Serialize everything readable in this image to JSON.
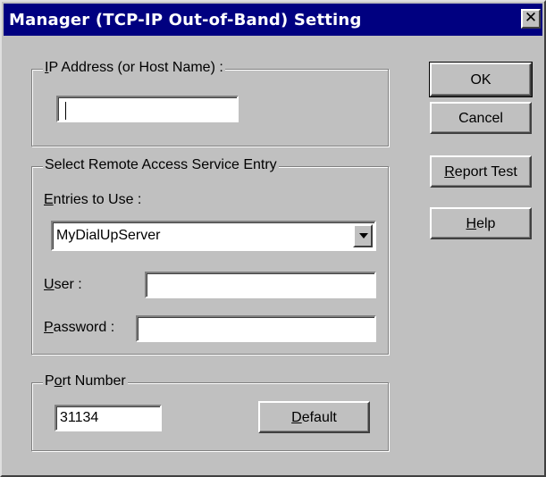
{
  "window": {
    "title": "Manager (TCP-IP Out-of-Band) Setting",
    "close_glyph": "✕"
  },
  "ip_group": {
    "legend_first": "I",
    "legend_rest": "P Address (or Host Name) :",
    "value": ""
  },
  "ras_group": {
    "legend": "Select Remote Access Service Entry",
    "entries_label_first": "E",
    "entries_label_rest": "ntries to Use :",
    "entries_selected": "MyDialUpServer",
    "user_label_first": "U",
    "user_label_rest": "ser :",
    "user_value": "",
    "password_label_first": "P",
    "password_label_rest": "assword :",
    "password_value": ""
  },
  "port_group": {
    "legend_first": "P",
    "legend_ul": "o",
    "legend_rest": "rt Number",
    "value": "31134",
    "default_first": "D",
    "default_rest": "efault"
  },
  "buttons": {
    "ok": "OK",
    "cancel": "Cancel",
    "report_first": "R",
    "report_rest": "eport Test",
    "help_first": "H",
    "help_rest": "elp"
  },
  "icons": {
    "close": "close-icon",
    "dropdown": "chevron-down-icon"
  }
}
